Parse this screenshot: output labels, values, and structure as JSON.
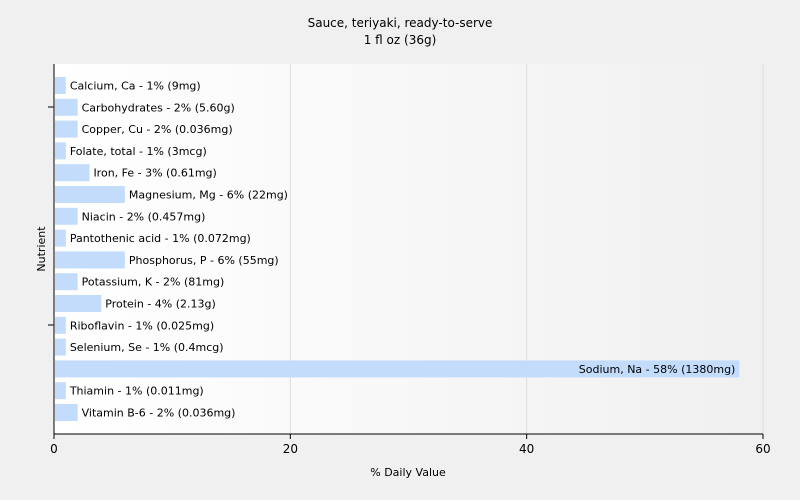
{
  "chart_data": {
    "type": "bar",
    "orientation": "horizontal",
    "title": "Sauce, teriyaki, ready-to-serve",
    "subtitle": "1 fl oz (36g)",
    "xlabel": "% Daily Value",
    "ylabel": "Nutrient",
    "xlim": [
      0,
      60
    ],
    "xticks": [
      "0",
      "20",
      "40",
      "60"
    ],
    "grid": true,
    "bar_color": "#c4dcfc",
    "categories": [
      "Calcium, Ca",
      "Carbohydrates",
      "Copper, Cu",
      "Folate, total",
      "Iron, Fe",
      "Magnesium, Mg",
      "Niacin",
      "Pantothenic acid",
      "Phosphorus, P",
      "Potassium, K",
      "Protein",
      "Riboflavin",
      "Selenium, Se",
      "Sodium, Na",
      "Thiamin",
      "Vitamin B-6"
    ],
    "values": [
      1,
      2,
      2,
      1,
      3,
      6,
      2,
      1,
      6,
      2,
      4,
      1,
      1,
      58,
      1,
      2
    ],
    "labels": [
      "Calcium, Ca - 1% (9mg)",
      "Carbohydrates - 2% (5.60g)",
      "Copper, Cu - 2% (0.036mg)",
      "Folate, total - 1% (3mcg)",
      "Iron, Fe - 3% (0.61mg)",
      "Magnesium, Mg - 6% (22mg)",
      "Niacin - 2% (0.457mg)",
      "Pantothenic acid - 1% (0.072mg)",
      "Phosphorus, P - 6% (55mg)",
      "Potassium, K - 2% (81mg)",
      "Protein - 4% (2.13g)",
      "Riboflavin - 1% (0.025mg)",
      "Selenium, Se - 1% (0.4mcg)",
      "Sodium, Na - 58% (1380mg)",
      "Thiamin - 1% (0.011mg)",
      "Vitamin B-6 - 2% (0.036mg)"
    ]
  }
}
